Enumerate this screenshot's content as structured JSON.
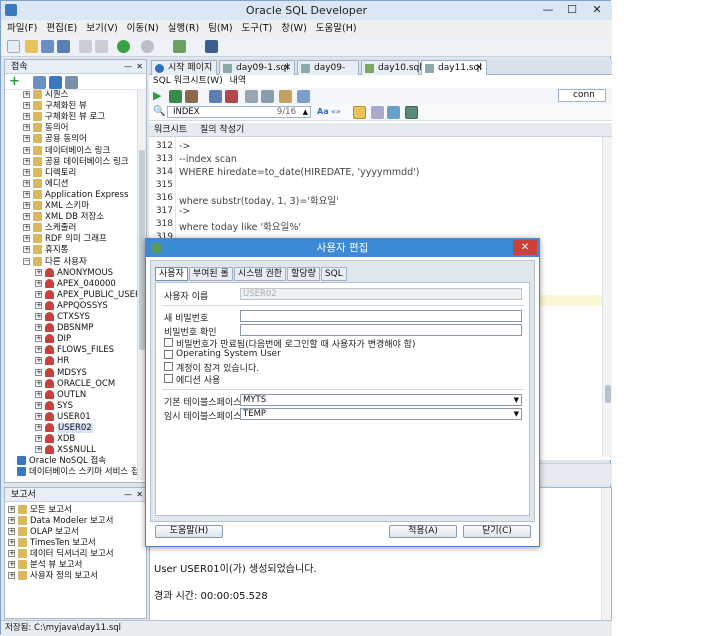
{
  "window": {
    "title": "Oracle SQL Developer",
    "minimize": "—",
    "maximize": "☐",
    "close": "✕"
  },
  "menu": [
    "파일(F)",
    "편집(E)",
    "보기(V)",
    "이동(N)",
    "실행(R)",
    "팀(M)",
    "도구(T)",
    "창(W)",
    "도움말(H)"
  ],
  "connections": {
    "header": "접속",
    "items": [
      {
        "label": "시퀀스",
        "level": 1
      },
      {
        "label": "구체화된 뷰",
        "level": 1
      },
      {
        "label": "구체화된 뷰 로그",
        "level": 1
      },
      {
        "label": "동의어",
        "level": 1
      },
      {
        "label": "공용 동의어",
        "level": 1
      },
      {
        "label": "데이터베이스 링크",
        "level": 1
      },
      {
        "label": "공용 데이터베이스 링크",
        "level": 1
      },
      {
        "label": "디렉토리",
        "level": 1
      },
      {
        "label": "에디션",
        "level": 1
      },
      {
        "label": "Application Express",
        "level": 1
      },
      {
        "label": "XML 스키마",
        "level": 1
      },
      {
        "label": "XML DB 저장소",
        "level": 1
      },
      {
        "label": "스케줄러",
        "level": 1
      },
      {
        "label": "RDF 의미 그래프",
        "level": 1
      },
      {
        "label": "휴지통",
        "level": 1
      },
      {
        "label": "다른 사용자",
        "level": 1,
        "open": true
      },
      {
        "label": "ANONYMOUS",
        "level": 2
      },
      {
        "label": "APEX_040000",
        "level": 2
      },
      {
        "label": "APEX_PUBLIC_USER",
        "level": 2
      },
      {
        "label": "APPQOSSYS",
        "level": 2
      },
      {
        "label": "CTXSYS",
        "level": 2
      },
      {
        "label": "DBSNMP",
        "level": 2
      },
      {
        "label": "DIP",
        "level": 2
      },
      {
        "label": "FLOWS_FILES",
        "level": 2
      },
      {
        "label": "HR",
        "level": 2
      },
      {
        "label": "MDSYS",
        "level": 2
      },
      {
        "label": "ORACLE_OCM",
        "level": 2
      },
      {
        "label": "OUTLN",
        "level": 2
      },
      {
        "label": "SYS",
        "level": 2
      },
      {
        "label": "USER01",
        "level": 2
      },
      {
        "label": "USER02",
        "level": 2,
        "selected": true
      },
      {
        "label": "XDB",
        "level": 2
      },
      {
        "label": "XS$NULL",
        "level": 2
      },
      {
        "label": "Oracle NoSQL 접속",
        "level": 0
      },
      {
        "label": "데이터베이스 스키마 서비스 접속",
        "level": 0
      }
    ]
  },
  "reports": {
    "header": "보고서",
    "items": [
      "모든 보고서",
      "Data Modeler 보고서",
      "OLAP 보고서",
      "TimesTen 보고서",
      "데이터 딕셔너리 보고서",
      "분석 뷰 보고서",
      "사용자 정의 보고서"
    ]
  },
  "tabs": [
    "시작 페이지",
    "day09-1.sql",
    "day09-2.sql",
    "day10.sql",
    "day11.sql"
  ],
  "editor": {
    "subtabs": [
      "SQL 워크시트(W)",
      "내역"
    ],
    "connection": "conn",
    "search_value": "INDEX",
    "search_count": "9/16",
    "worksheet_tabs": [
      "워크시트",
      "질의 작성기"
    ],
    "lines": [
      {
        "num": "312",
        "text": "->"
      },
      {
        "num": "313",
        "text": "--index scan"
      },
      {
        "num": "314",
        "text": "WHERE hiredate=to_date(HIREDATE, 'yyyymmdd')"
      },
      {
        "num": "315",
        "text": ""
      },
      {
        "num": "316",
        "text": "where substr(today, 1, 3)='화요일'"
      },
      {
        "num": "317",
        "text": "->"
      },
      {
        "num": "318",
        "text": "where today like '화요일%'"
      },
      {
        "num": "319",
        "text": ""
      }
    ]
  },
  "output": {
    "message": "User USER01이(가) 생성되었습니다.",
    "elapsed": "경과 시간: 00:00:05.528"
  },
  "status": "저장됨: C:\\myjava\\day11.sql",
  "dialog": {
    "title": "사용자 편집",
    "tabs": [
      "사용자",
      "부여된 롤",
      "시스템 권한",
      "할당량",
      "SQL"
    ],
    "username_label": "사용자 이름",
    "username_value": "USER02",
    "new_password_label": "새 비밀번호",
    "confirm_password_label": "비밀번호 확인",
    "checks": [
      "비밀번호가 만료됨(다음번에 로그인할 때 사용자가 변경해야 함)",
      "Operating System User",
      "계정이 잠겨 있습니다.",
      "에디션 사용"
    ],
    "default_ts_label": "기본 테이블스페이스",
    "default_ts_value": "MYTS",
    "temp_ts_label": "임시 테이블스페이스",
    "temp_ts_value": "TEMP",
    "help_button": "도움말(H)",
    "apply_button": "적용(A)",
    "close_button": "닫기(C)"
  }
}
